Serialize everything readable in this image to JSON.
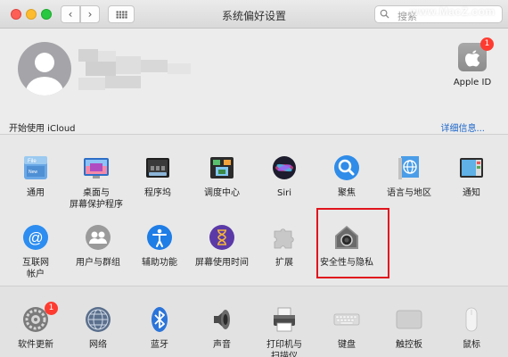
{
  "window": {
    "title": "系统偏好设置",
    "search_placeholder": "搜索",
    "watermark": "www.MacZ.com"
  },
  "account": {
    "apple_id_label": "Apple ID",
    "apple_id_badge": "1",
    "icloud_prompt": "开始使用 iCloud",
    "details_link": "详细信息..."
  },
  "row1": [
    {
      "label": "通用",
      "icon": "general-icon"
    },
    {
      "label": "桌面与\n屏幕保护程序",
      "icon": "desktop-screensaver-icon"
    },
    {
      "label": "程序坞",
      "icon": "dock-icon"
    },
    {
      "label": "调度中心",
      "icon": "mission-control-icon"
    },
    {
      "label": "Siri",
      "icon": "siri-icon"
    },
    {
      "label": "聚焦",
      "icon": "spotlight-icon"
    },
    {
      "label": "语言与地区",
      "icon": "language-region-icon"
    },
    {
      "label": "通知",
      "icon": "notifications-icon"
    }
  ],
  "row2": [
    {
      "label": "互联网\n帐户",
      "icon": "internet-accounts-icon"
    },
    {
      "label": "用户与群组",
      "icon": "users-groups-icon"
    },
    {
      "label": "辅助功能",
      "icon": "accessibility-icon"
    },
    {
      "label": "屏幕使用时间",
      "icon": "screen-time-icon"
    },
    {
      "label": "扩展",
      "icon": "extensions-icon"
    },
    {
      "label": "安全性与隐私",
      "icon": "security-privacy-icon"
    }
  ],
  "row3": [
    {
      "label": "软件更新",
      "icon": "software-update-icon",
      "badge": "1"
    },
    {
      "label": "网络",
      "icon": "network-icon"
    },
    {
      "label": "蓝牙",
      "icon": "bluetooth-icon"
    },
    {
      "label": "声音",
      "icon": "sound-icon"
    },
    {
      "label": "打印机与\n扫描仪",
      "icon": "printers-scanners-icon"
    },
    {
      "label": "键盘",
      "icon": "keyboard-icon"
    },
    {
      "label": "触控板",
      "icon": "trackpad-icon"
    },
    {
      "label": "鼠标",
      "icon": "mouse-icon"
    }
  ],
  "colors": {
    "highlight": "#e0141d",
    "link": "#1a64c8",
    "badge": "#fe3b30"
  }
}
